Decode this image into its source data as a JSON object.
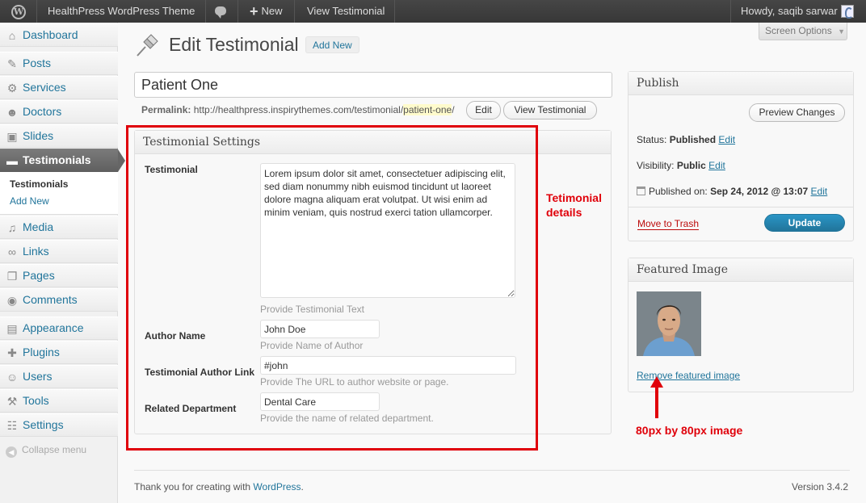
{
  "admin_bar": {
    "site_name": "HealthPress WordPress Theme",
    "new_label": "New",
    "view_label": "View Testimonial",
    "howdy": "Howdy, saqib sarwar"
  },
  "sidebar": {
    "items": [
      {
        "label": "Dashboard",
        "icon": "dashboard-icon"
      },
      {
        "label": "Posts",
        "icon": "pin-icon"
      },
      {
        "label": "Services",
        "icon": "gear-icon"
      },
      {
        "label": "Doctors",
        "icon": "users-icon"
      },
      {
        "label": "Slides",
        "icon": "image-icon"
      },
      {
        "label": "Testimonials",
        "icon": "comment-icon"
      },
      {
        "label": "Media",
        "icon": "media-icon"
      },
      {
        "label": "Links",
        "icon": "link-icon"
      },
      {
        "label": "Pages",
        "icon": "page-icon"
      },
      {
        "label": "Comments",
        "icon": "comments-icon"
      },
      {
        "label": "Appearance",
        "icon": "appearance-icon"
      },
      {
        "label": "Plugins",
        "icon": "plugin-icon"
      },
      {
        "label": "Users",
        "icon": "user-icon"
      },
      {
        "label": "Tools",
        "icon": "tools-icon"
      },
      {
        "label": "Settings",
        "icon": "settings-icon"
      }
    ],
    "submenu": [
      "Testimonials",
      "Add New"
    ],
    "collapse": "Collapse menu"
  },
  "header": {
    "screen_options": "Screen Options",
    "title": "Edit Testimonial",
    "add_new": "Add New"
  },
  "post": {
    "title": "Patient One",
    "permalink_label": "Permalink:",
    "permalink_base": "http://healthpress.inspirythemes.com/testimonial/",
    "permalink_slug": "patient-one",
    "permalink_end": "/",
    "edit_btn": "Edit",
    "view_btn": "View Testimonial"
  },
  "settings_box": {
    "title": "Testimonial Settings",
    "testimonial_label": "Testimonial",
    "testimonial_text": "Lorem ipsum dolor sit amet, consectetuer adipiscing elit, sed diam nonummy nibh euismod tincidunt ut laoreet dolore magna aliquam erat volutpat. Ut wisi enim ad minim veniam, quis nostrud exerci tation ullamcorper.",
    "testimonial_hint": "Provide Testimonial Text",
    "author_label": "Author Name",
    "author_value": "John Doe",
    "author_hint": "Provide Name of Author",
    "link_label": "Testimonial Author Link",
    "link_value": "#john",
    "link_hint": "Provide The URL to author website or page.",
    "dept_label": "Related Department",
    "dept_value": "Dental Care",
    "dept_hint": "Provide the name of related department."
  },
  "annotations": {
    "box_note_line1": "Tetimonial",
    "box_note_line2": "details",
    "image_note": "80px by 80px image",
    "color": "#e0000a"
  },
  "publish": {
    "title": "Publish",
    "preview": "Preview Changes",
    "status_label": "Status:",
    "status_value": "Published",
    "visibility_label": "Visibility:",
    "visibility_value": "Public",
    "published_label": "Published on:",
    "published_value": "Sep 24, 2012 @ 13:07",
    "edit": "Edit",
    "trash": "Move to Trash",
    "update": "Update"
  },
  "featured": {
    "title": "Featured Image",
    "remove": "Remove featured image"
  },
  "footer": {
    "thanks": "Thank you for creating with ",
    "wordpress": "WordPress",
    "period": ".",
    "version": "Version 3.4.2"
  }
}
